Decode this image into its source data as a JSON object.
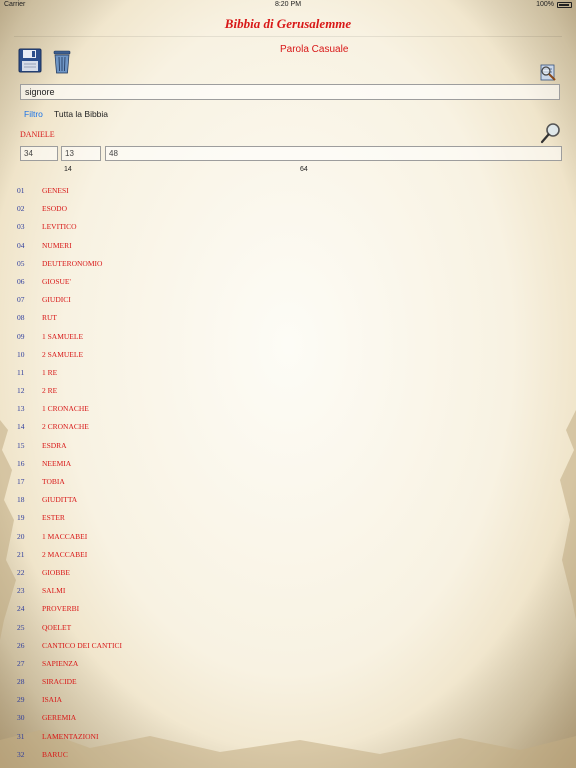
{
  "status_bar": {
    "carrier": "Carrier",
    "time": "8:20 PM",
    "battery": "100%"
  },
  "header": {
    "title": "Bibbia di Gerusalemme"
  },
  "toolbar": {
    "save_icon": "floppy-disk-icon",
    "trash_icon": "trash-icon",
    "random_word_label": "Parola Casuale",
    "lookup_icon": "book-search-icon"
  },
  "search": {
    "value": "signore",
    "placeholder": ""
  },
  "scope": {
    "options": [
      "Filtro",
      "Tutta la Bibbia"
    ],
    "selected": "Filtro"
  },
  "book_selector": {
    "book_name": "DANIELE",
    "field_book": "34",
    "field_chapter": "13",
    "field_verse": "48",
    "sub_label_1": "14",
    "sub_label_2": "64",
    "magnifier_icon": "magnifier-icon"
  },
  "books": [
    {
      "num": "01",
      "name": "GENESI"
    },
    {
      "num": "02",
      "name": "ESODO"
    },
    {
      "num": "03",
      "name": "LEVITICO"
    },
    {
      "num": "04",
      "name": "NUMERI"
    },
    {
      "num": "05",
      "name": "DEUTERONOMIO"
    },
    {
      "num": "06",
      "name": "GIOSUE'"
    },
    {
      "num": "07",
      "name": "GIUDICI"
    },
    {
      "num": "08",
      "name": "RUT"
    },
    {
      "num": "09",
      "name": "1 SAMUELE"
    },
    {
      "num": "10",
      "name": "2 SAMUELE"
    },
    {
      "num": "11",
      "name": "1 RE"
    },
    {
      "num": "12",
      "name": "2 RE"
    },
    {
      "num": "13",
      "name": "1 CRONACHE"
    },
    {
      "num": "14",
      "name": "2 CRONACHE"
    },
    {
      "num": "15",
      "name": "ESDRA"
    },
    {
      "num": "16",
      "name": "NEEMIA"
    },
    {
      "num": "17",
      "name": "TOBIA"
    },
    {
      "num": "18",
      "name": "GIUDITTA"
    },
    {
      "num": "19",
      "name": "ESTER"
    },
    {
      "num": "20",
      "name": "1 MACCABEI"
    },
    {
      "num": "21",
      "name": "2 MACCABEI"
    },
    {
      "num": "22",
      "name": "GIOBBE"
    },
    {
      "num": "23",
      "name": "SALMI"
    },
    {
      "num": "24",
      "name": "PROVERBI"
    },
    {
      "num": "25",
      "name": "QOELET"
    },
    {
      "num": "26",
      "name": "CANTICO DEI CANTICI"
    },
    {
      "num": "27",
      "name": "SAPIENZA"
    },
    {
      "num": "28",
      "name": "SIRACIDE"
    },
    {
      "num": "29",
      "name": "ISAIA"
    },
    {
      "num": "30",
      "name": "GEREMIA"
    },
    {
      "num": "31",
      "name": "LAMENTAZIONI"
    },
    {
      "num": "32",
      "name": "BARUC"
    }
  ],
  "colors": {
    "accent_red": "#d81818",
    "number_blue": "#2d3c9c",
    "link_blue": "#1a73e8"
  }
}
